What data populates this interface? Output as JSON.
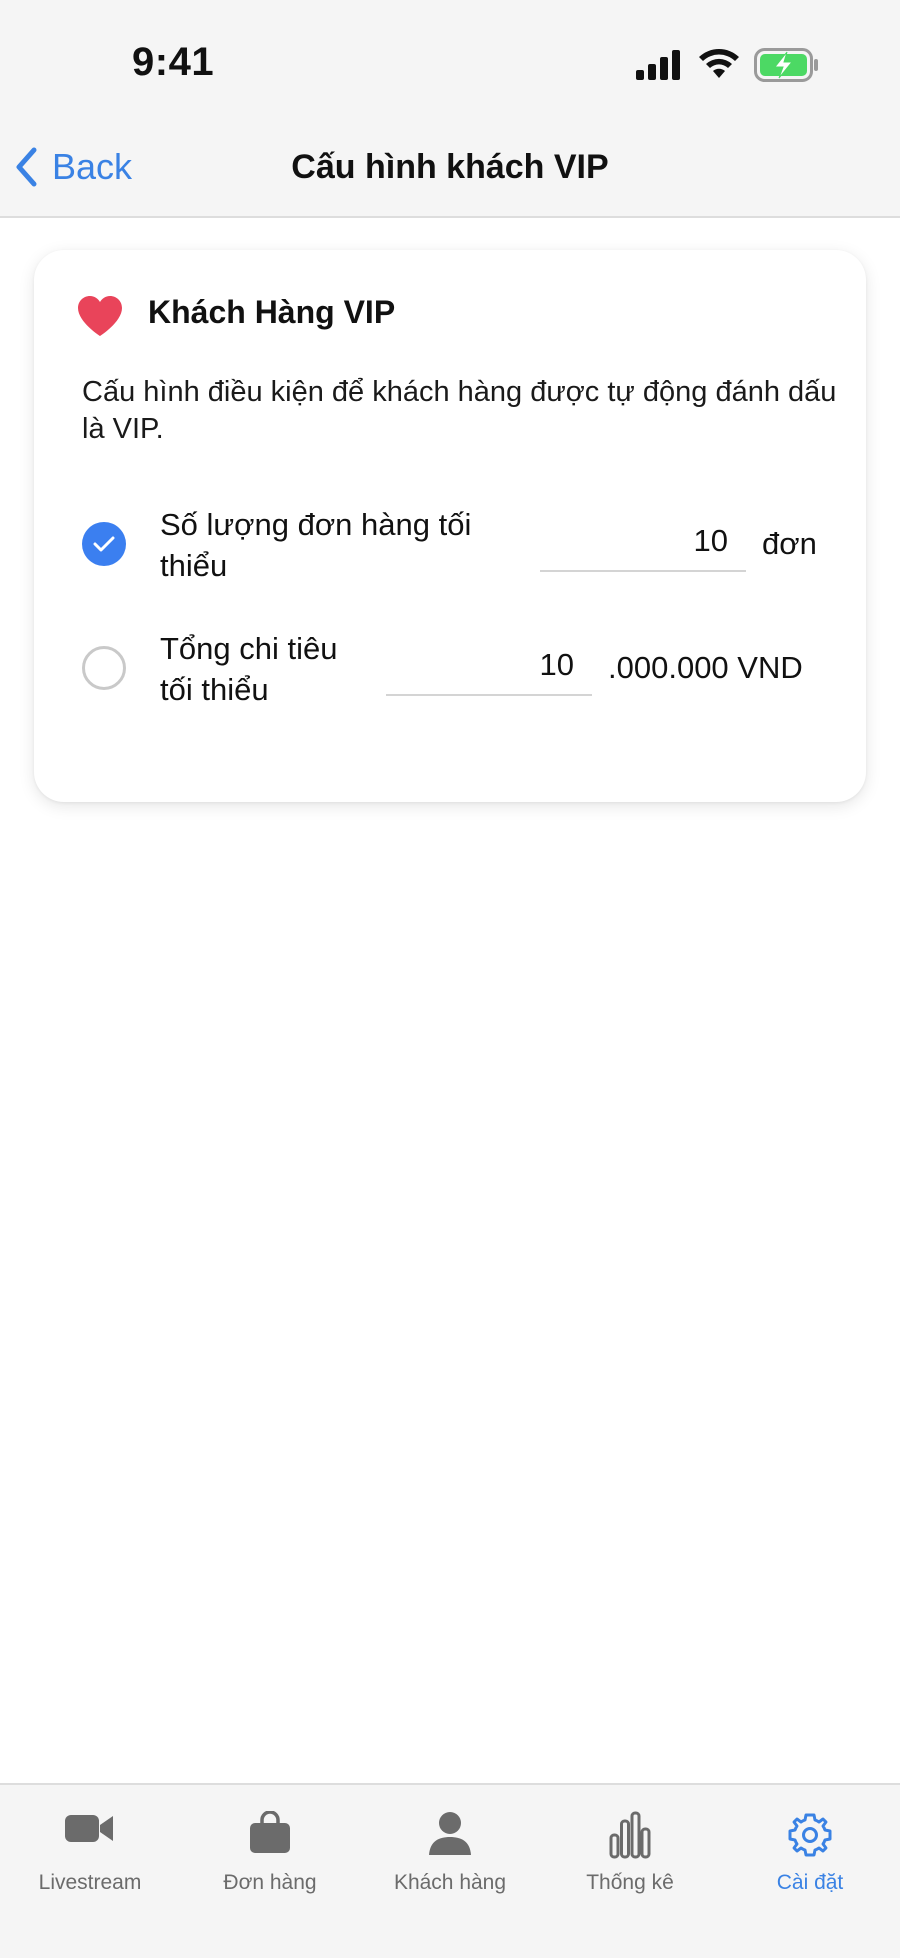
{
  "status": {
    "time": "9:41"
  },
  "nav": {
    "back_label": "Back",
    "title": "Cấu hình khách VIP"
  },
  "card": {
    "title": "Khách Hàng VIP",
    "description": "Cấu hình điều kiện để khách hàng được tự động đánh dấu là VIP.",
    "options": [
      {
        "label_line1": "Số lượng đơn hàng tối",
        "label_line2": "thiểu",
        "value": "10",
        "unit": "đơn",
        "selected": true
      },
      {
        "label_line1": "Tổng chi tiêu",
        "label_line2": "tối thiểu",
        "value": "10",
        "unit": ".000.000 VND",
        "selected": false
      }
    ]
  },
  "tabs": [
    {
      "label": "Livestream",
      "icon": "video-camera-icon",
      "active": false
    },
    {
      "label": "Đơn hàng",
      "icon": "shopping-bag-icon",
      "active": false
    },
    {
      "label": "Khách hàng",
      "icon": "person-icon",
      "active": false
    },
    {
      "label": "Thống kê",
      "icon": "bar-chart-icon",
      "active": false
    },
    {
      "label": "Cài đặt",
      "icon": "gear-icon",
      "active": true
    }
  ],
  "colors": {
    "accent": "#3a82e4",
    "heart": "#e9445a",
    "battery": "#4cd964",
    "inactive_tab": "#6b6b6b"
  }
}
